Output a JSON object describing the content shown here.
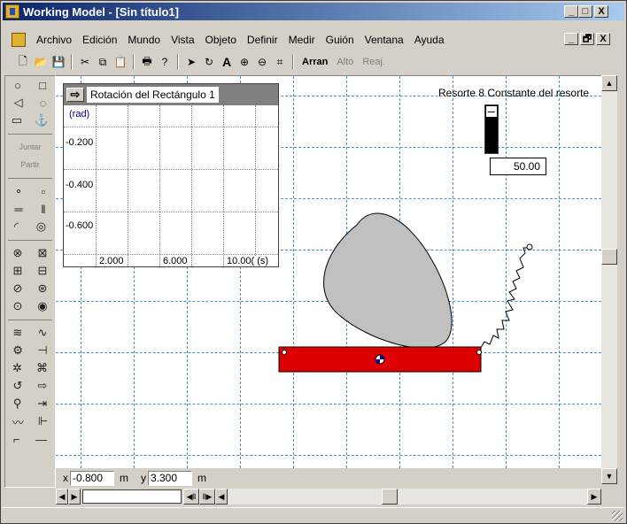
{
  "window": {
    "title": "Working Model - [Sin título1]",
    "controls": [
      "_",
      "□",
      "X"
    ],
    "doc_controls": [
      "_",
      "🗗",
      "X"
    ]
  },
  "menu": {
    "items": [
      "Archivo",
      "Edición",
      "Mundo",
      "Vista",
      "Objeto",
      "Definir",
      "Medir",
      "Guión",
      "Ventana",
      "Ayuda"
    ]
  },
  "toolbar": {
    "run_label": "Arran",
    "stop_label": "Alto",
    "reset_label": "Reaj."
  },
  "palette": {
    "join_label": "Juntar",
    "split_label": "Partir"
  },
  "meter": {
    "title": "Rotación del Rectángulo 1",
    "y_unit": "(rad)",
    "y_ticks": [
      "-0.200",
      "-0.400",
      "-0.600"
    ],
    "x_ticks": [
      "2.000",
      "6.000",
      "10.00( (s)"
    ]
  },
  "spring": {
    "title": "Resorte 8 Constante del resorte",
    "value": "50.00"
  },
  "coords": {
    "x_label": "x",
    "x_value": "-0.800",
    "x_unit": "m",
    "y_label": "y",
    "y_value": "3.300",
    "y_unit": "m"
  },
  "colors": {
    "title_bar_start": "#0a246a",
    "title_bar_end": "#a6caf0",
    "rectangle_fill": "#dd0000",
    "body_fill": "#c0c0c0",
    "grid_line": "#4a90c8"
  }
}
